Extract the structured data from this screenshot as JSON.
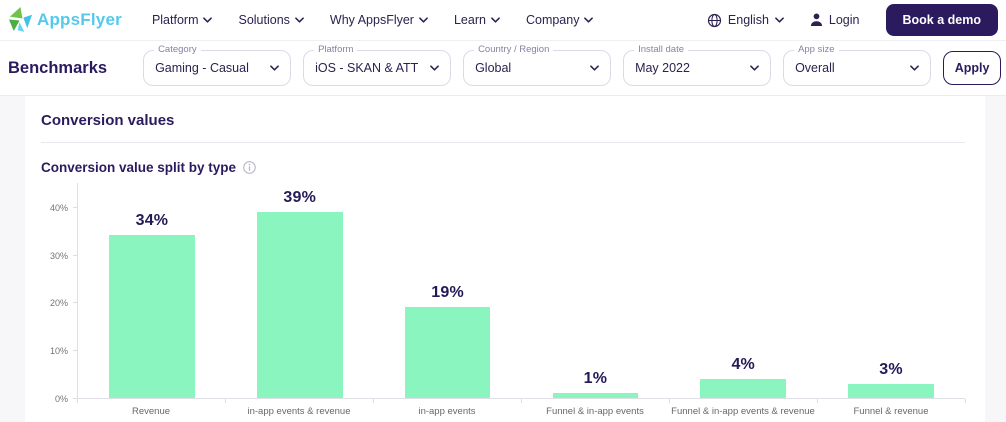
{
  "nav": {
    "logo_text": "AppsFlyer",
    "items": [
      {
        "label": "Platform"
      },
      {
        "label": "Solutions"
      },
      {
        "label": "Why AppsFlyer"
      },
      {
        "label": "Learn"
      },
      {
        "label": "Company"
      }
    ],
    "language": "English",
    "login_label": "Login",
    "cta_label": "Book a demo"
  },
  "filter_bar": {
    "title": "Benchmarks",
    "filters": [
      {
        "label": "Category",
        "value": "Gaming - Casual"
      },
      {
        "label": "Platform",
        "value": "iOS - SKAN & ATT"
      },
      {
        "label": "Country / Region",
        "value": "Global"
      },
      {
        "label": "Install date",
        "value": "May 2022"
      },
      {
        "label": "App size",
        "value": "Overall"
      }
    ],
    "apply_label": "Apply"
  },
  "content": {
    "section_title": "Conversion values"
  },
  "chart_data": {
    "type": "bar",
    "title": "Conversion value split by type",
    "categories": [
      "Revenue",
      "in-app events & revenue",
      "in-app events",
      "Funnel & in-app events",
      "Funnel & in-app events & revenue",
      "Funnel & revenue"
    ],
    "values": [
      34,
      39,
      19,
      1,
      4,
      3
    ],
    "value_labels": [
      "34%",
      "39%",
      "19%",
      "1%",
      "4%",
      "3%"
    ],
    "yticks": [
      0,
      10,
      20,
      30,
      40
    ],
    "ytick_labels": [
      "0%",
      "10%",
      "20%",
      "30%",
      "40%"
    ],
    "ylim": [
      0,
      45
    ],
    "grid": false,
    "legend": "none",
    "bar_color": "#8AF5BE",
    "value_label_color": "#241A56"
  },
  "colors": {
    "brand_navy": "#2B1B5E",
    "accent_mint": "#8AF5BE",
    "logo_blue": "#55C9EC",
    "logo_green": "#6FC24A",
    "logo_cyan": "#3FC1EA"
  }
}
